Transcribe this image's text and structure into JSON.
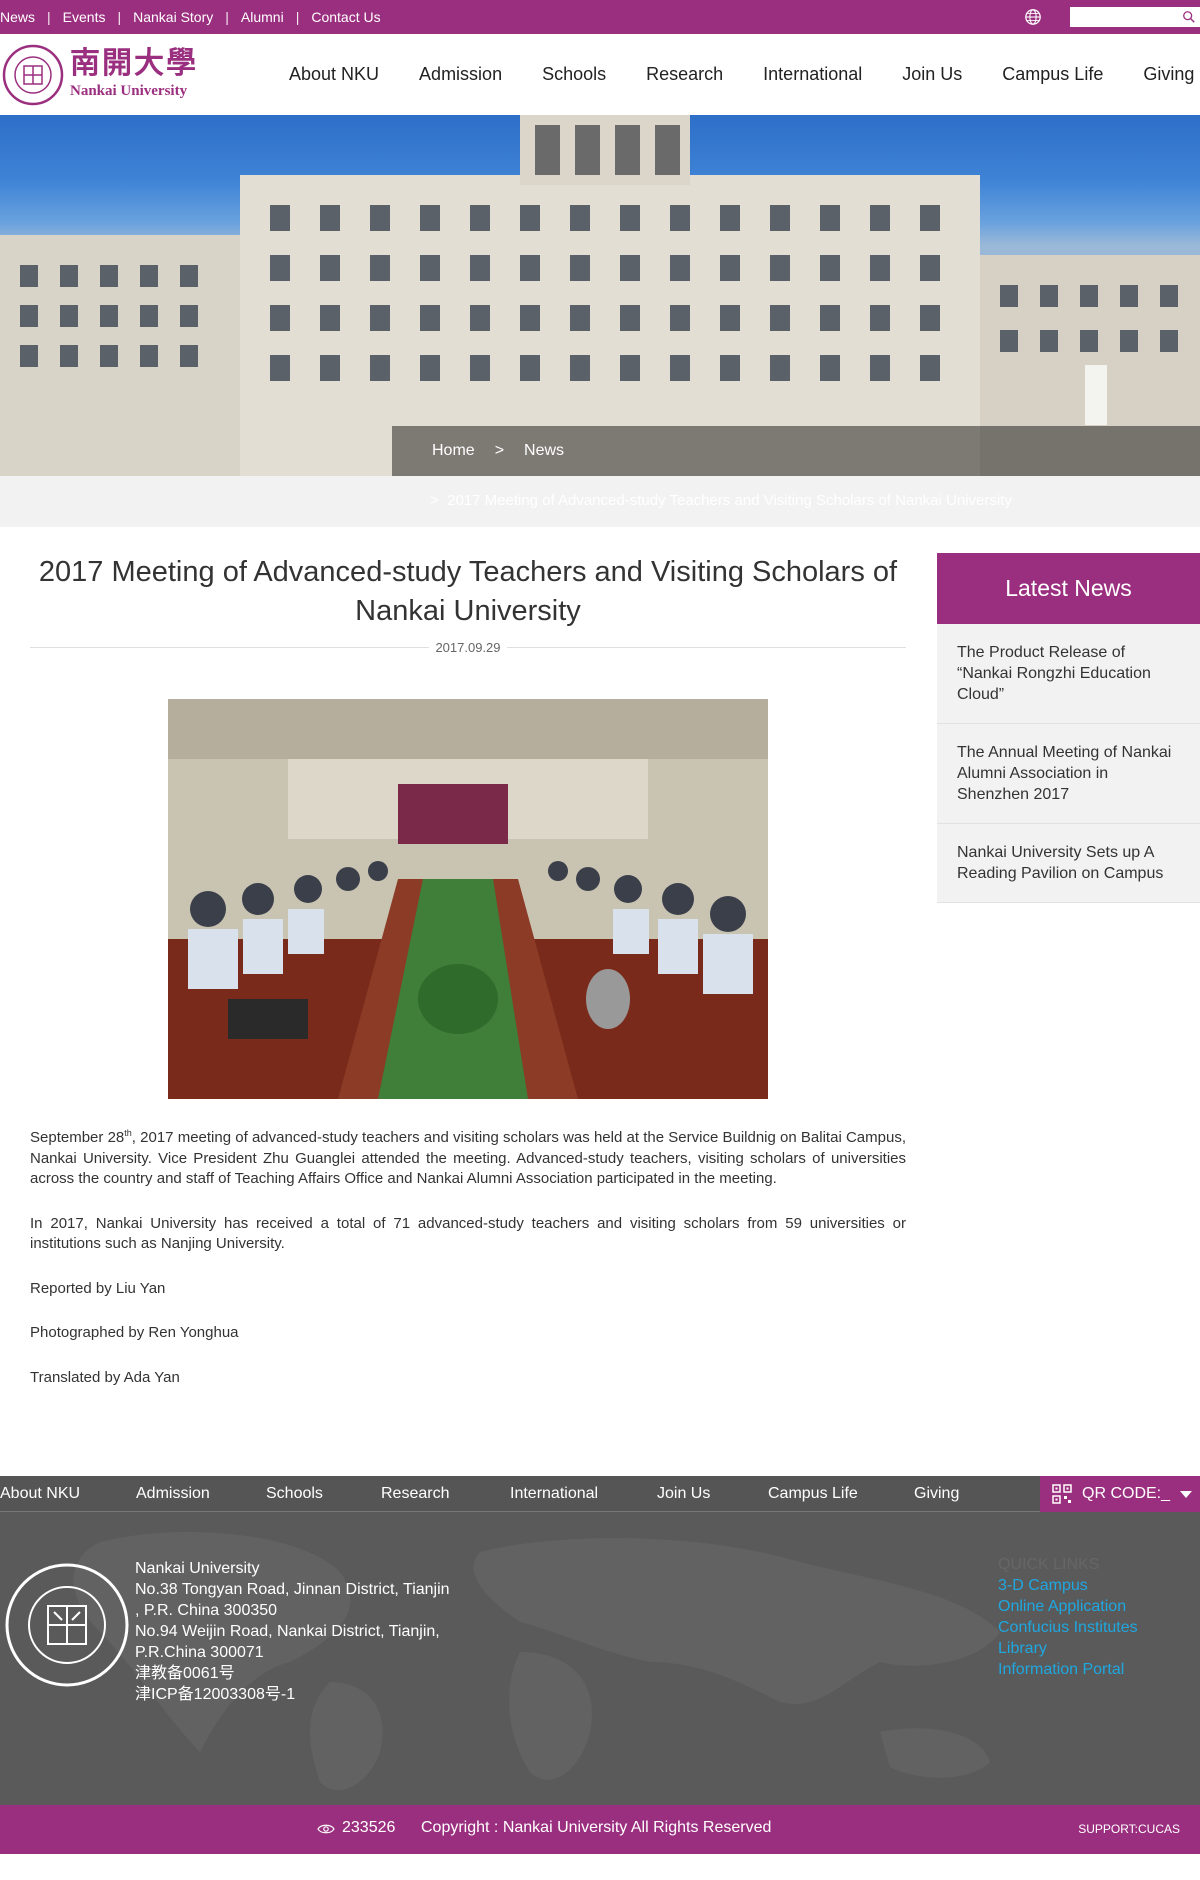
{
  "topbar": {
    "links": [
      "News",
      "Events",
      "Nankai Story",
      "Alumni",
      "Contact Us"
    ],
    "search_placeholder": ""
  },
  "logo": {
    "cn": "南開大學",
    "en": "Nankai University"
  },
  "nav": [
    "About NKU",
    "Admission",
    "Schools",
    "Research",
    "International",
    "Join Us",
    "Campus Life",
    "Giving"
  ],
  "breadcrumb": {
    "home": "Home",
    "arrow": ">",
    "section": "News",
    "sub_arrow": ">",
    "current": "2017 Meeting of Advanced-study Teachers and Visiting Scholars of Nankai University"
  },
  "article": {
    "title": "2017 Meeting of Advanced-study Teachers and Visiting Scholars of Nankai University",
    "date": "2017.09.29",
    "p1_start": "September 28",
    "p1_sup": "th",
    "p1_rest": ", 2017 meeting of advanced-study teachers and visiting scholars was held at the Service Buildnig on Balitai Campus, Nankai University. Vice President Zhu Guanglei attended the meeting. Advanced-study teachers, visiting scholars of universities across the country and staff of Teaching Affairs Office and Nankai Alumni Association participated in the meeting.",
    "p2": "In 2017, Nankai University has received a total of 71 advanced-study teachers and visiting scholars from 59 universities or institutions such as Nanjing University.",
    "p3": "Reported by Liu Yan",
    "p4": "Photographed by Ren Yonghua",
    "p5": "Translated by Ada Yan"
  },
  "sidebar": {
    "title": "Latest News",
    "items": [
      "The Product Release of “Nankai Rongzhi Education Cloud”",
      "The Annual Meeting of Nankai Alumni Association in Shenzhen 2017",
      "Nankai University Sets up A Reading Pavilion on Campus"
    ]
  },
  "footer": {
    "nav": [
      "About NKU",
      "Admission",
      "Schools",
      "Research",
      "International",
      "Join Us",
      "Campus Life",
      "Giving"
    ],
    "qr_label": "QR CODE:_",
    "address": [
      "Nankai University",
      "No.38 Tongyan Road, Jinnan District, Tianjin",
      ", P.R. China 300350",
      "No.94 Weijin Road,  Nankai District, Tianjin,",
      "P.R.China  300071",
      "津教备0061号",
      "津ICP备12003308号-1"
    ],
    "quick_title": "QUICK LINKS",
    "quick_links": [
      "3-D Campus",
      "Online Application",
      "Confucius Institutes",
      "Library",
      "Information Portal"
    ],
    "visits": "233526",
    "copyright": "Copyright : Nankai University All Rights Reserved",
    "support": "SUPPORT:CUCAS"
  },
  "colors": {
    "brand": "#9b2f7f",
    "link_blue": "#1fa7e0",
    "footer_bg": "#5a5a5a"
  }
}
